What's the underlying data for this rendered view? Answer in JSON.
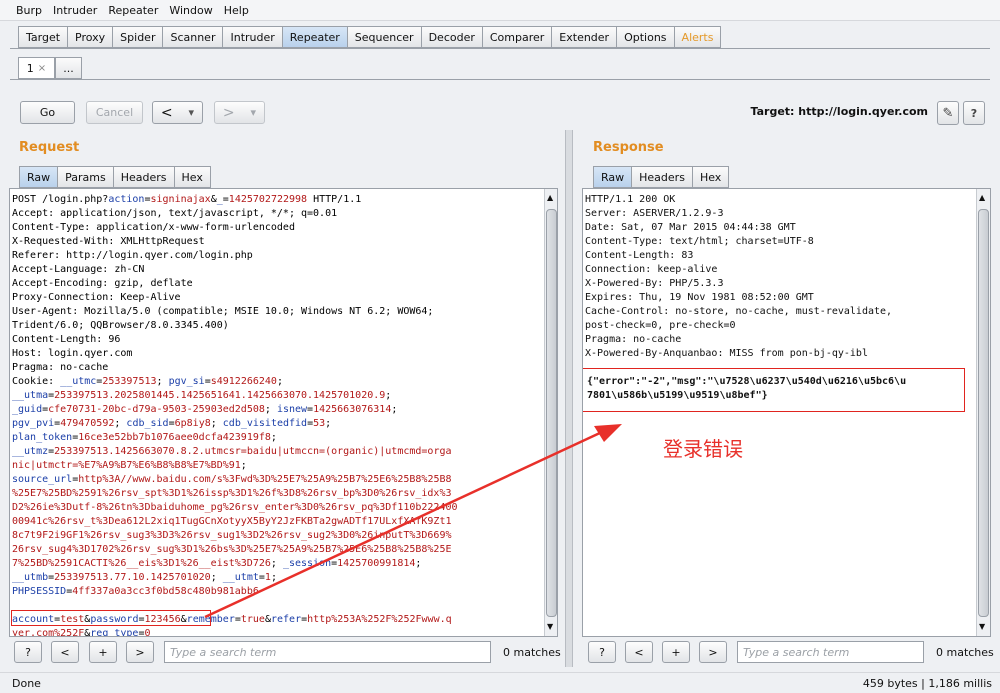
{
  "menu": [
    "Burp",
    "Intruder",
    "Repeater",
    "Window",
    "Help"
  ],
  "main_tabs": [
    "Target",
    "Proxy",
    "Spider",
    "Scanner",
    "Intruder",
    "Repeater",
    "Sequencer",
    "Decoder",
    "Comparer",
    "Extender",
    "Options",
    "Alerts"
  ],
  "sub_tabs": {
    "first": "1",
    "close": "×",
    "more": "..."
  },
  "toolbar": {
    "go": "Go",
    "cancel": "Cancel",
    "back": "<",
    "forward": ">",
    "dropdown": "▾",
    "target": "Target: http://login.qyer.com",
    "edit_icon": "✎",
    "help": "?"
  },
  "request": {
    "title": "Request",
    "tabs": [
      "Raw",
      "Params",
      "Headers",
      "Hex"
    ],
    "lines": [
      [
        [
          "k",
          "POST /login.php?"
        ],
        [
          "p",
          "action"
        ],
        [
          "k",
          "="
        ],
        [
          "v",
          "signinajax"
        ],
        [
          "k",
          "&"
        ],
        [
          "p",
          "_"
        ],
        [
          "k",
          "="
        ],
        [
          "v",
          "1425702722998"
        ],
        [
          "k",
          " HTTP/1.1"
        ]
      ],
      [
        [
          "k",
          "Accept: application/json, text/javascript, */*; q=0.01"
        ]
      ],
      [
        [
          "k",
          "Content-Type: application/x-www-form-urlencoded"
        ]
      ],
      [
        [
          "k",
          "X-Requested-With: XMLHttpRequest"
        ]
      ],
      [
        [
          "k",
          "Referer: http://login.qyer.com/login.php"
        ]
      ],
      [
        [
          "k",
          "Accept-Language: zh-CN"
        ]
      ],
      [
        [
          "k",
          "Accept-Encoding: gzip, deflate"
        ]
      ],
      [
        [
          "k",
          "Proxy-Connection: Keep-Alive"
        ]
      ],
      [
        [
          "k",
          "User-Agent: Mozilla/5.0 (compatible; MSIE 10.0; Windows NT 6.2; WOW64;"
        ]
      ],
      [
        [
          "k",
          "Trident/6.0; QQBrowser/8.0.3345.400)"
        ]
      ],
      [
        [
          "k",
          "Content-Length: 96"
        ]
      ],
      [
        [
          "k",
          "Host: login.qyer.com"
        ]
      ],
      [
        [
          "k",
          "Pragma: no-cache"
        ]
      ],
      [
        [
          "k",
          "Cookie: "
        ],
        [
          "p",
          "__utmc"
        ],
        [
          "k",
          "="
        ],
        [
          "v",
          "253397513"
        ],
        [
          "k",
          "; "
        ],
        [
          "p",
          "pgv_si"
        ],
        [
          "k",
          "="
        ],
        [
          "v",
          "s4912266240"
        ],
        [
          "k",
          ";"
        ]
      ],
      [
        [
          "p",
          "__utma"
        ],
        [
          "k",
          "="
        ],
        [
          "v",
          "253397513.2025801445.1425651641.1425663070.1425701020.9"
        ],
        [
          "k",
          ";"
        ]
      ],
      [
        [
          "p",
          "_guid"
        ],
        [
          "k",
          "="
        ],
        [
          "v",
          "cfe70731-20bc-d79a-9503-25903ed2d508"
        ],
        [
          "k",
          "; "
        ],
        [
          "p",
          "isnew"
        ],
        [
          "k",
          "="
        ],
        [
          "v",
          "1425663076314"
        ],
        [
          "k",
          ";"
        ]
      ],
      [
        [
          "p",
          "pgv_pvi"
        ],
        [
          "k",
          "="
        ],
        [
          "v",
          "479470592"
        ],
        [
          "k",
          "; "
        ],
        [
          "p",
          "cdb_sid"
        ],
        [
          "k",
          "="
        ],
        [
          "v",
          "6p8iy8"
        ],
        [
          "k",
          "; "
        ],
        [
          "p",
          "cdb_visitedfid"
        ],
        [
          "k",
          "="
        ],
        [
          "v",
          "53"
        ],
        [
          "k",
          ";"
        ]
      ],
      [
        [
          "p",
          "plan_token"
        ],
        [
          "k",
          "="
        ],
        [
          "v",
          "16ce3e52bb7b1076aee0dcfa423919f8"
        ],
        [
          "k",
          ";"
        ]
      ],
      [
        [
          "p",
          "__utmz"
        ],
        [
          "k",
          "="
        ],
        [
          "v",
          "253397513.1425663070.8.2.utmcsr=baidu|utmccn=(organic)|utmcmd=orga"
        ]
      ],
      [
        [
          "v",
          "nic|utmctr=%E7%A9%B7%E6%B8%B8%E7%BD%91"
        ],
        [
          "k",
          ";"
        ]
      ],
      [
        [
          "p",
          "source_url"
        ],
        [
          "k",
          "="
        ],
        [
          "v",
          "http%3A//www.baidu.com/s%3Fwd%3D%25E7%25A9%25B7%25E6%25B8%25B8"
        ]
      ],
      [
        [
          "v",
          "%25E7%25BD%2591%26rsv_spt%3D1%26issp%3D1%26f%3D8%26rsv_bp%3D0%26rsv_idx%3"
        ]
      ],
      [
        [
          "v",
          "D2%26ie%3Dutf-8%26tn%3Dbaiduhome_pg%26rsv_enter%3D0%26rsv_pq%3Df110b222400"
        ]
      ],
      [
        [
          "v",
          "00941c%26rsv_t%3Dea612L2xiq1TugGCnXotyyX5ByY2JzFKBTa2gwADTf17ULxfXAfK9Zt1"
        ]
      ],
      [
        [
          "v",
          "8c7t9F2i9GF1%26rsv_sug3%3D3%26rsv_sug1%3D2%26rsv_sug2%3D0%26inputT%3D669%"
        ]
      ],
      [
        [
          "v",
          "26rsv_sug4%3D1702%26rsv_sug%3D1%26bs%3D%25E7%25A9%25B7%25E6%25B8%25B8%25E"
        ]
      ],
      [
        [
          "v",
          "7%25BD%2591CACTI%26__eis%3D1%26__eist%3D726"
        ],
        [
          "k",
          "; "
        ],
        [
          "p",
          "_session"
        ],
        [
          "k",
          "="
        ],
        [
          "v",
          "1425700991814"
        ],
        [
          "k",
          ";"
        ]
      ],
      [
        [
          "p",
          "__utmb"
        ],
        [
          "k",
          "="
        ],
        [
          "v",
          "253397513.77.10.1425701020"
        ],
        [
          "k",
          "; "
        ],
        [
          "p",
          "__utmt"
        ],
        [
          "k",
          "="
        ],
        [
          "v",
          "1"
        ],
        [
          "k",
          ";"
        ]
      ],
      [
        [
          "p",
          "PHPSESSID"
        ],
        [
          "k",
          "="
        ],
        [
          "v",
          "4ff337a0a3cc3f0bd58c480b981abb6"
        ]
      ],
      [],
      [
        [
          "p",
          "account"
        ],
        [
          "k",
          "="
        ],
        [
          "v",
          "test"
        ],
        [
          "k",
          "&"
        ],
        [
          "p",
          "password"
        ],
        [
          "k",
          "="
        ],
        [
          "v",
          "123456"
        ],
        [
          "k",
          "&"
        ],
        [
          "p",
          "remember"
        ],
        [
          "k",
          "="
        ],
        [
          "v",
          "true"
        ],
        [
          "k",
          "&"
        ],
        [
          "p",
          "refer"
        ],
        [
          "k",
          "="
        ],
        [
          "v",
          "http%253A%252F%252Fwww.q"
        ]
      ],
      [
        [
          "v",
          "yer.com%252F"
        ],
        [
          "k",
          "&"
        ],
        [
          "p",
          "reg_type"
        ],
        [
          "k",
          "="
        ],
        [
          "v",
          "0"
        ]
      ]
    ]
  },
  "response": {
    "title": "Response",
    "tabs": [
      "Raw",
      "Headers",
      "Hex"
    ],
    "lines": [
      "HTTP/1.1 200 OK",
      "Server: ASERVER/1.2.9-3",
      "Date: Sat, 07 Mar 2015 04:44:38 GMT",
      "Content-Type: text/html; charset=UTF-8",
      "Content-Length: 83",
      "Connection: keep-alive",
      "X-Powered-By: PHP/5.3.3",
      "Expires: Thu, 19 Nov 1981 08:52:00 GMT",
      "Cache-Control: no-store, no-cache, must-revalidate,",
      "post-check=0, pre-check=0",
      "Pragma: no-cache",
      "X-Powered-By-Anquanbao: MISS from pon-bj-qy-ibl"
    ],
    "body_lines": [
      "{\"error\":\"-2\",\"msg\":\"\\u7528\\u6237\\u540d\\u6216\\u5bc6\\u",
      "7801\\u586b\\u5199\\u9519\\u8bef\"}"
    ]
  },
  "annotation": "登录错误",
  "search": {
    "help": "?",
    "prev": "<",
    "add": "+",
    "next": ">",
    "placeholder": "Type a search term",
    "matches": "0 matches"
  },
  "status": {
    "left": "Done",
    "right": "459 bytes | 1,186 millis"
  },
  "colors": {
    "accent": "#e28d22",
    "param": "#1c3fa8",
    "value": "#b21818",
    "annotation": "#e8302a"
  }
}
